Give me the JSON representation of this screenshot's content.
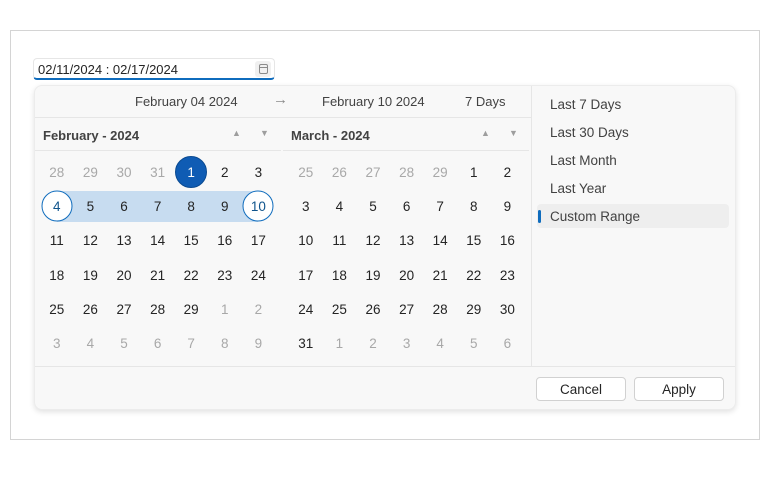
{
  "input": {
    "value": "02/11/2024 : 02/17/2024",
    "icon": "calendar-icon"
  },
  "range_header": {
    "start_label": "February 04 2024",
    "arrow_glyph": "→",
    "end_label": "February 10 2024",
    "duration_label": "7 Days"
  },
  "months": [
    {
      "title": "February - 2024",
      "nav_up_glyph": "▲",
      "nav_down_glyph": "▼",
      "days": [
        {
          "n": "28",
          "other": true
        },
        {
          "n": "29",
          "other": true
        },
        {
          "n": "30",
          "other": true
        },
        {
          "n": "31",
          "other": true
        },
        {
          "n": "1",
          "today": true
        },
        {
          "n": "2"
        },
        {
          "n": "3"
        },
        {
          "n": "4",
          "start": true
        },
        {
          "n": "5",
          "range": true
        },
        {
          "n": "6",
          "range": true
        },
        {
          "n": "7",
          "range": true
        },
        {
          "n": "8",
          "range": true
        },
        {
          "n": "9",
          "range": true
        },
        {
          "n": "10",
          "end": true
        },
        {
          "n": "11"
        },
        {
          "n": "12"
        },
        {
          "n": "13"
        },
        {
          "n": "14"
        },
        {
          "n": "15"
        },
        {
          "n": "16"
        },
        {
          "n": "17"
        },
        {
          "n": "18"
        },
        {
          "n": "19"
        },
        {
          "n": "20"
        },
        {
          "n": "21"
        },
        {
          "n": "22"
        },
        {
          "n": "23"
        },
        {
          "n": "24"
        },
        {
          "n": "25"
        },
        {
          "n": "26"
        },
        {
          "n": "27"
        },
        {
          "n": "28"
        },
        {
          "n": "29"
        },
        {
          "n": "1",
          "other": true
        },
        {
          "n": "2",
          "other": true
        },
        {
          "n": "3",
          "other": true
        },
        {
          "n": "4",
          "other": true
        },
        {
          "n": "5",
          "other": true
        },
        {
          "n": "6",
          "other": true
        },
        {
          "n": "7",
          "other": true
        },
        {
          "n": "8",
          "other": true
        },
        {
          "n": "9",
          "other": true
        }
      ]
    },
    {
      "title": "March - 2024",
      "nav_up_glyph": "▲",
      "nav_down_glyph": "▼",
      "days": [
        {
          "n": "25",
          "other": true
        },
        {
          "n": "26",
          "other": true
        },
        {
          "n": "27",
          "other": true
        },
        {
          "n": "28",
          "other": true
        },
        {
          "n": "29",
          "other": true
        },
        {
          "n": "1"
        },
        {
          "n": "2"
        },
        {
          "n": "3"
        },
        {
          "n": "4"
        },
        {
          "n": "5"
        },
        {
          "n": "6"
        },
        {
          "n": "7"
        },
        {
          "n": "8"
        },
        {
          "n": "9"
        },
        {
          "n": "10"
        },
        {
          "n": "11"
        },
        {
          "n": "12"
        },
        {
          "n": "13"
        },
        {
          "n": "14"
        },
        {
          "n": "15"
        },
        {
          "n": "16"
        },
        {
          "n": "17"
        },
        {
          "n": "18"
        },
        {
          "n": "19"
        },
        {
          "n": "20"
        },
        {
          "n": "21"
        },
        {
          "n": "22"
        },
        {
          "n": "23"
        },
        {
          "n": "24"
        },
        {
          "n": "25"
        },
        {
          "n": "26"
        },
        {
          "n": "27"
        },
        {
          "n": "28"
        },
        {
          "n": "29"
        },
        {
          "n": "30"
        },
        {
          "n": "31"
        },
        {
          "n": "1",
          "other": true
        },
        {
          "n": "2",
          "other": true
        },
        {
          "n": "3",
          "other": true
        },
        {
          "n": "4",
          "other": true
        },
        {
          "n": "5",
          "other": true
        },
        {
          "n": "6",
          "other": true
        }
      ]
    }
  ],
  "presets": [
    {
      "label": "Last 7 Days",
      "selected": false
    },
    {
      "label": "Last 30 Days",
      "selected": false
    },
    {
      "label": "Last Month",
      "selected": false
    },
    {
      "label": "Last Year",
      "selected": false
    },
    {
      "label": "Custom Range",
      "selected": true
    }
  ],
  "footer": {
    "cancel_label": "Cancel",
    "apply_label": "Apply"
  },
  "colors": {
    "accent": "#0f6cbd",
    "today_fill": "#0f5cb4",
    "range_fill": "#c7dcf0"
  }
}
